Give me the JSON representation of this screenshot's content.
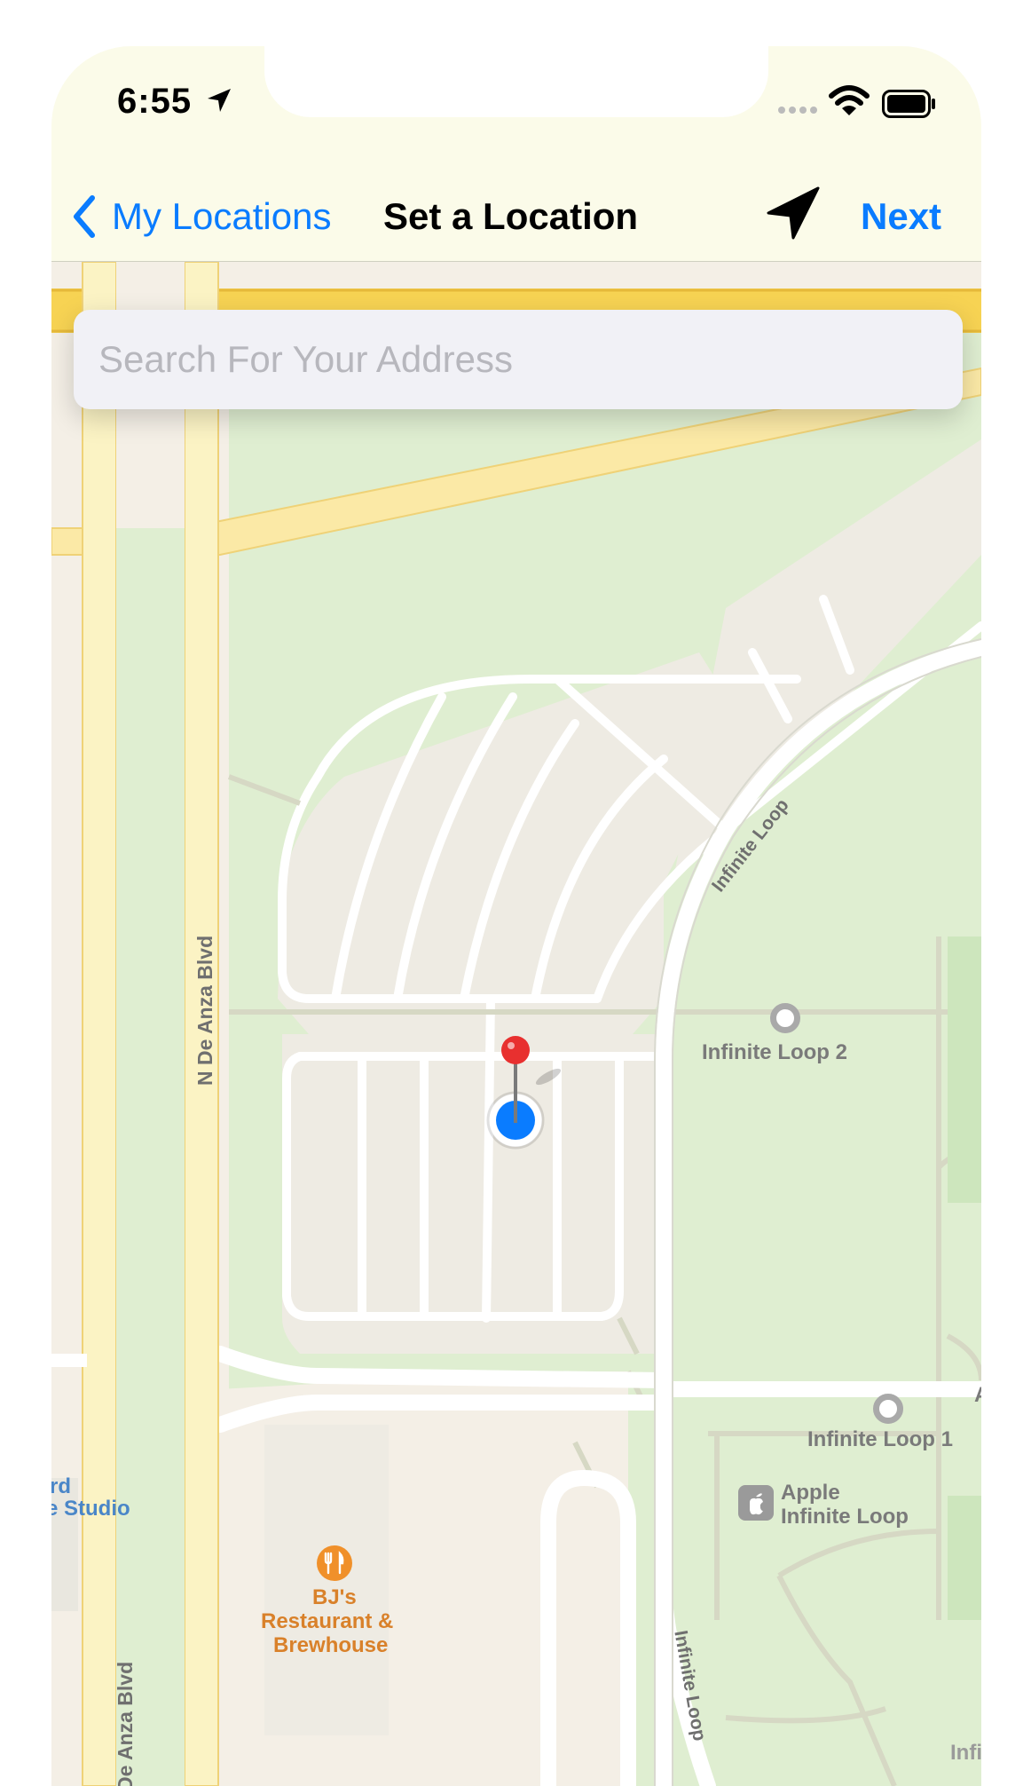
{
  "status": {
    "time": "6:55"
  },
  "nav": {
    "back_label": "My Locations",
    "title": "Set a Location",
    "next_label": "Next"
  },
  "search": {
    "placeholder": "Search For Your Address",
    "value": ""
  },
  "map_labels": {
    "road_de_anza_upper": "N De Anza Blvd",
    "road_de_anza_lower": "N De Anza Blvd",
    "road_infinite_loop_curve": "Infinite Loop",
    "road_infinite_loop_south": "Infinite Loop",
    "place_loop_2": "Infinite Loop 2",
    "place_loop_1": "Infinite Loop 1",
    "apple_line1": "Apple",
    "apple_line2": "Infinite Loop",
    "bjs_line1": "BJ's",
    "bjs_line2": "Restaurant &",
    "bjs_line3": "Brewhouse",
    "studio_line1": "rd",
    "studio_line2": "e Studio",
    "edge_infi": "Infi",
    "edge_a": "A"
  },
  "colors": {
    "accent": "#0a7cff",
    "pin": "#e8302f",
    "user_location": "#0a7cff",
    "restaurant": "#f0902a",
    "park": "#dfeed1",
    "major_road": "#fbe9a6",
    "highway": "#f7d353"
  },
  "icons": {
    "back": "chevron-left-icon",
    "navigation": "location-arrow-icon",
    "pin": "map-pin-icon",
    "user": "user-location-icon",
    "restaurant": "fork-knife-icon",
    "apple": "apple-logo-icon"
  }
}
